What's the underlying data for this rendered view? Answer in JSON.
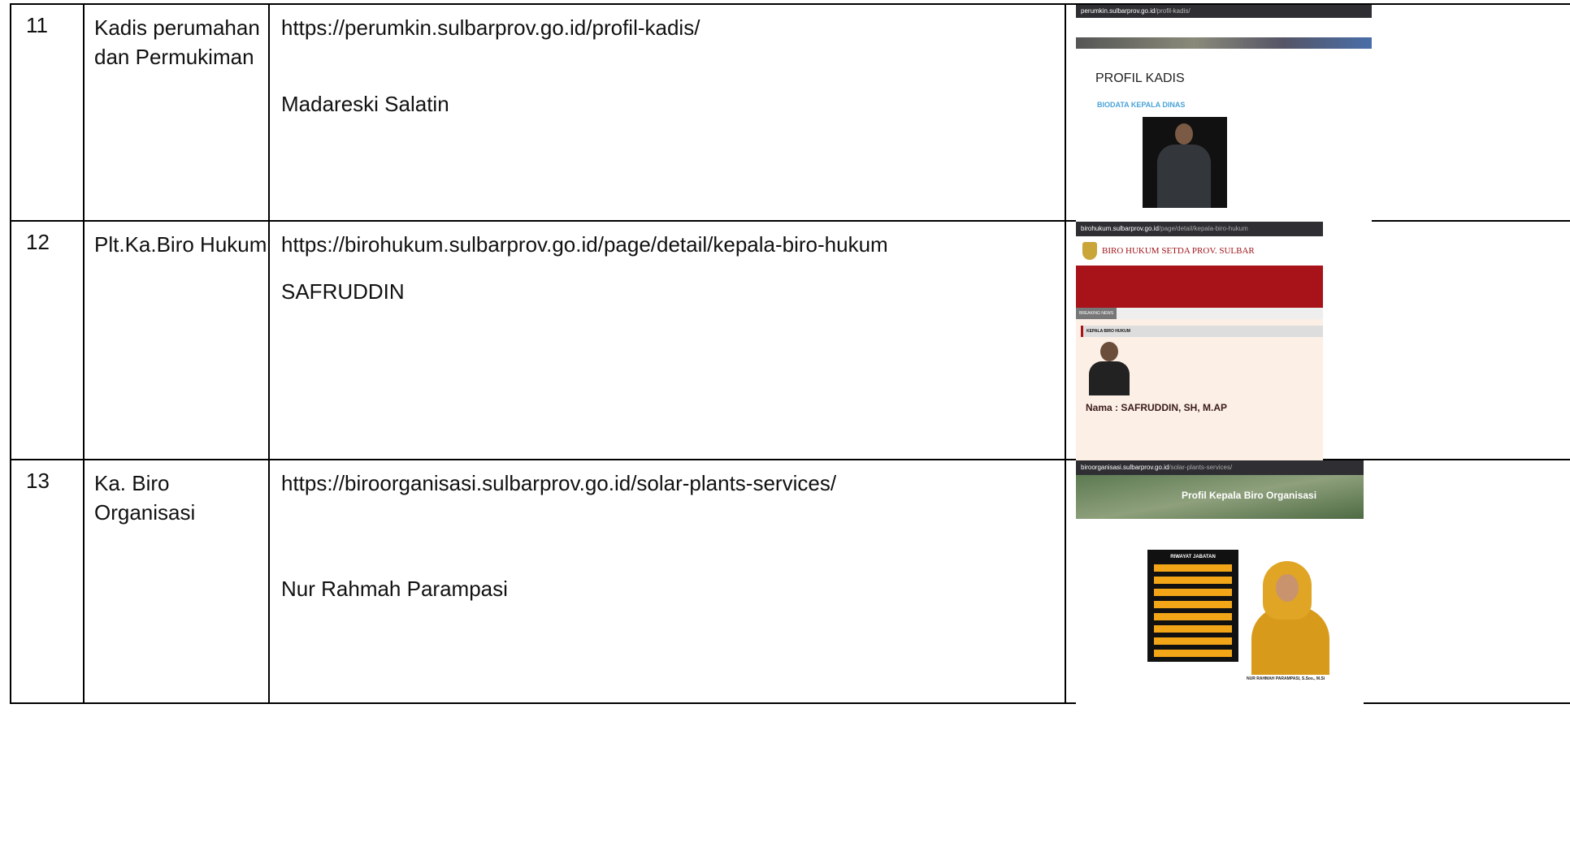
{
  "rows": [
    {
      "no": "11",
      "title": "Kadis perumahan dan Permukiman",
      "url": "https://perumkin.sulbarprov.go.id/profil-kadis/",
      "person": "Madareski Salatin",
      "shot": {
        "address_host": "perumkin.sulbarprov.go.id",
        "address_path": "/profil-kadis/",
        "heading": "PROFIL KADIS",
        "subheading": "BIODATA KEPALA DINAS"
      }
    },
    {
      "no": "12",
      "title": "Plt.Ka.Biro Hukum",
      "url": "https://birohukum.sulbarprov.go.id/page/detail/kepala-biro-hukum",
      "person": "SAFRUDDIN",
      "shot": {
        "address_host": "birohukum.sulbarprov.go.id",
        "address_path": "/page/detail/kepala-biro-hukum",
        "logo_text": "BIRO HUKUM SETDA PROV. SULBAR",
        "ticker_tag": "BREAKING NEWS",
        "section": "KEPALA BIRO HUKUM",
        "name_line": "Nama : SAFRUDDIN, SH, M.AP"
      }
    },
    {
      "no": "13",
      "title": "Ka. Biro Organisasi",
      "url": "https://biroorganisasi.sulbarprov.go.id/solar-plants-services/",
      "person": "Nur Rahmah Parampasi",
      "shot": {
        "address_host": "biroorganisasi.sulbarprov.go.id",
        "address_path": "/solar-plants-services/",
        "hero": "Profil Kepala Biro Organisasi",
        "box_title": "RIWAYAT JABATAN",
        "caption": "NUR RAHMAH PARAMPASI, S.Sos., M.Si"
      }
    }
  ]
}
